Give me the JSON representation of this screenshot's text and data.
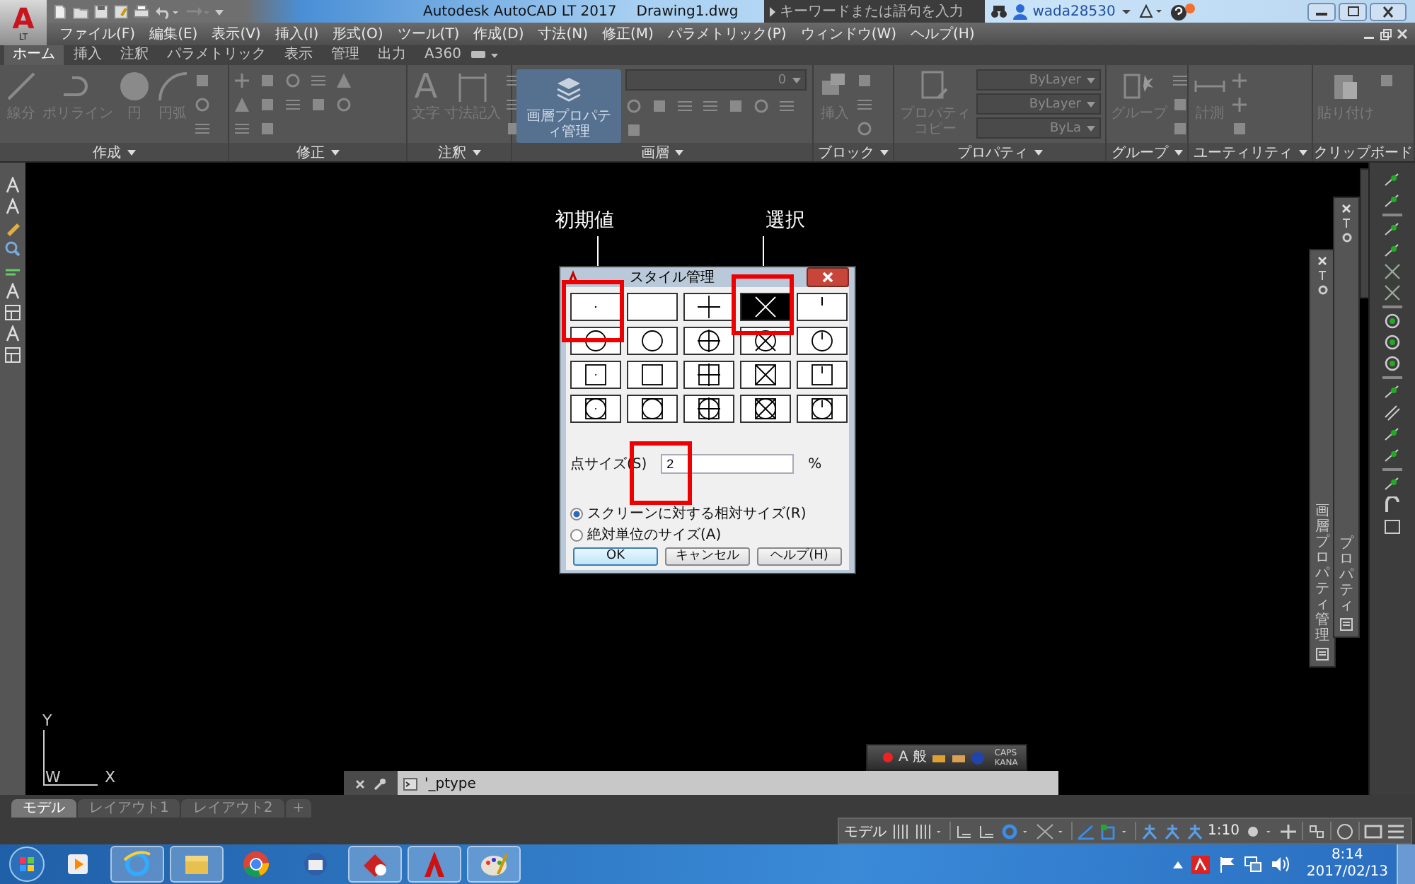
{
  "title_bar": {
    "logo": "A",
    "edition": "LT",
    "title": "Autodesk AutoCAD LT 2017",
    "document": "Drawing1.dwg",
    "search": {
      "placeholder": "キーワードまたは語句を入力"
    },
    "user": "wada28530"
  },
  "menu": [
    "ファイル(F)",
    "編集(E)",
    "表示(V)",
    "挿入(I)",
    "形式(O)",
    "ツール(T)",
    "作成(D)",
    "寸法(N)",
    "修正(M)",
    "パラメトリック(P)",
    "ウィンドウ(W)",
    "ヘルプ(H)"
  ],
  "ribbon_tabs": [
    {
      "label": "ホーム",
      "selected": true
    },
    {
      "label": "挿入",
      "selected": false
    },
    {
      "label": "注釈",
      "selected": false
    },
    {
      "label": "パラメトリック",
      "selected": false
    },
    {
      "label": "表示",
      "selected": false
    },
    {
      "label": "管理",
      "selected": false
    },
    {
      "label": "出力",
      "selected": false
    },
    {
      "label": "A360",
      "selected": false
    }
  ],
  "ribbon_panels": [
    {
      "title": "作成",
      "has_menu": true,
      "tools": [
        {
          "kind": "line",
          "label": "線分"
        },
        {
          "kind": "polyline",
          "label": "ポリライン"
        },
        {
          "kind": "circle",
          "label": "円"
        },
        {
          "kind": "arc",
          "label": "円弧"
        }
      ]
    },
    {
      "title": "修正",
      "has_menu": true
    },
    {
      "title": "注釈",
      "has_menu": true,
      "tools": [
        {
          "kind": "text",
          "glyph": "A",
          "label": "文字"
        },
        {
          "kind": "dimension",
          "label": "寸法記入"
        }
      ]
    },
    {
      "title": "画層",
      "has_menu": true,
      "tools": [
        {
          "kind": "layers",
          "label": "画層プロパティ管理"
        }
      ],
      "fields": [
        "0"
      ]
    },
    {
      "title": "ブロック",
      "has_menu": true,
      "tools": [
        {
          "kind": "insert",
          "label": "挿入"
        }
      ]
    },
    {
      "title": "プロパティ",
      "has_menu": true,
      "tools": [
        {
          "kind": "match",
          "label": "プロパティコピー"
        }
      ],
      "fields": [
        "ByLayer",
        "ByLayer",
        "ByLa"
      ]
    },
    {
      "title": "グループ",
      "has_menu": true,
      "tools": [
        {
          "kind": "group",
          "label": "グループ"
        }
      ]
    },
    {
      "title": "ユーティリティ",
      "has_menu": true,
      "tools": [
        {
          "kind": "measure",
          "label": "計測"
        }
      ]
    },
    {
      "title": "クリップボード",
      "has_menu": false,
      "tools": [
        {
          "kind": "paste",
          "label": "貼り付け"
        }
      ]
    }
  ],
  "annotations": [
    {
      "label": "初期値"
    },
    {
      "label": "選択"
    }
  ],
  "dialog": {
    "title": "スタイル管理",
    "styles": [
      {
        "kind": "dot",
        "selected": false
      },
      {
        "kind": "blank",
        "selected": false
      },
      {
        "kind": "plus",
        "selected": false
      },
      {
        "kind": "cross",
        "selected": true
      },
      {
        "kind": "tick",
        "selected": false
      },
      {
        "kind": "circle-dot",
        "selected": false
      },
      {
        "kind": "circle-blank",
        "selected": false
      },
      {
        "kind": "circle-plus",
        "selected": false
      },
      {
        "kind": "circle-cross",
        "selected": false
      },
      {
        "kind": "circle-tick",
        "selected": false
      },
      {
        "kind": "square-dot",
        "selected": false
      },
      {
        "kind": "square-blank",
        "selected": false
      },
      {
        "kind": "square-plus",
        "selected": false
      },
      {
        "kind": "square-cross",
        "selected": false
      },
      {
        "kind": "square-tick",
        "selected": false
      },
      {
        "kind": "both-dot",
        "selected": false
      },
      {
        "kind": "both-blank",
        "selected": false
      },
      {
        "kind": "both-plus",
        "selected": false
      },
      {
        "kind": "both-cross",
        "selected": false
      },
      {
        "kind": "both-tick",
        "selected": false
      }
    ],
    "size_label": "点サイズ(S)",
    "size_value": "2",
    "size_unit": "%",
    "options": [
      {
        "label": "スクリーンに対する相対サイズ(R)",
        "selected": true
      },
      {
        "label": "絶対単位のサイズ(A)",
        "selected": false
      }
    ],
    "buttons": [
      {
        "label": "OK",
        "default": true
      },
      {
        "label": "キャンセル",
        "default": false
      },
      {
        "label": "ヘルプ(H)",
        "default": false
      }
    ]
  },
  "ucs": {
    "y": "Y",
    "origin": "W",
    "x": "X"
  },
  "palettes": [
    {
      "title": "画層プロパティ管理"
    },
    {
      "title": "プロパティ"
    }
  ],
  "ime_bar": {
    "mode": "A",
    "input": "般",
    "caps": "CAPS",
    "kana": "KANA"
  },
  "command_line": {
    "text": "'_ptype"
  },
  "layout_tabs": [
    {
      "label": "モデル",
      "selected": true
    },
    {
      "label": "レイアウト1",
      "selected": false
    },
    {
      "label": "レイアウト2",
      "selected": false
    }
  ],
  "add_tab": "+",
  "status_bar": {
    "space": "モデル",
    "scale": "1:10"
  },
  "taskbar": {
    "apps": [
      {
        "kind": "media",
        "running": false
      },
      {
        "kind": "browser",
        "running": true
      },
      {
        "kind": "folder",
        "running": true
      },
      {
        "kind": "chrome",
        "running": false
      },
      {
        "kind": "mail",
        "running": false
      },
      {
        "kind": "paint-shop",
        "running": true
      },
      {
        "kind": "cad",
        "running": true
      },
      {
        "kind": "palette",
        "running": true
      }
    ],
    "time": "8:14",
    "date": "2017/02/13"
  }
}
